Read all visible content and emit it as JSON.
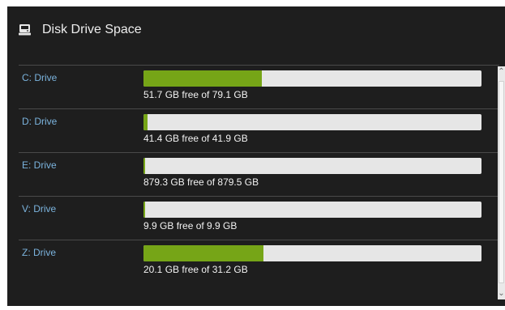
{
  "header": {
    "icon": "hard-drive-icon",
    "title": "Disk Drive Space"
  },
  "colors": {
    "panel_background": "#1e1e1e",
    "drive_label": "#7bb3dd",
    "usage_fill": "#76a517",
    "bar_track": "#e6e6e6",
    "text": "#f2f2f2"
  },
  "drives": [
    {
      "label": "C: Drive",
      "usage_text": "51.7 GB free of 79.1 GB",
      "used_fraction": 0.35
    },
    {
      "label": "D: Drive",
      "usage_text": "41.4 GB free of 41.9 GB",
      "used_fraction": 0.012
    },
    {
      "label": "E: Drive",
      "usage_text": "879.3 GB free of 879.5 GB",
      "used_fraction": 0.0002
    },
    {
      "label": "V: Drive",
      "usage_text": "9.9 GB free of 9.9 GB",
      "used_fraction": 0.003
    },
    {
      "label": "Z: Drive",
      "usage_text": "20.1 GB free of 31.2 GB",
      "used_fraction": 0.356
    }
  ],
  "scrollbar": {
    "up_icon": "chevron-up-icon",
    "down_icon": "chevron-down-icon"
  }
}
